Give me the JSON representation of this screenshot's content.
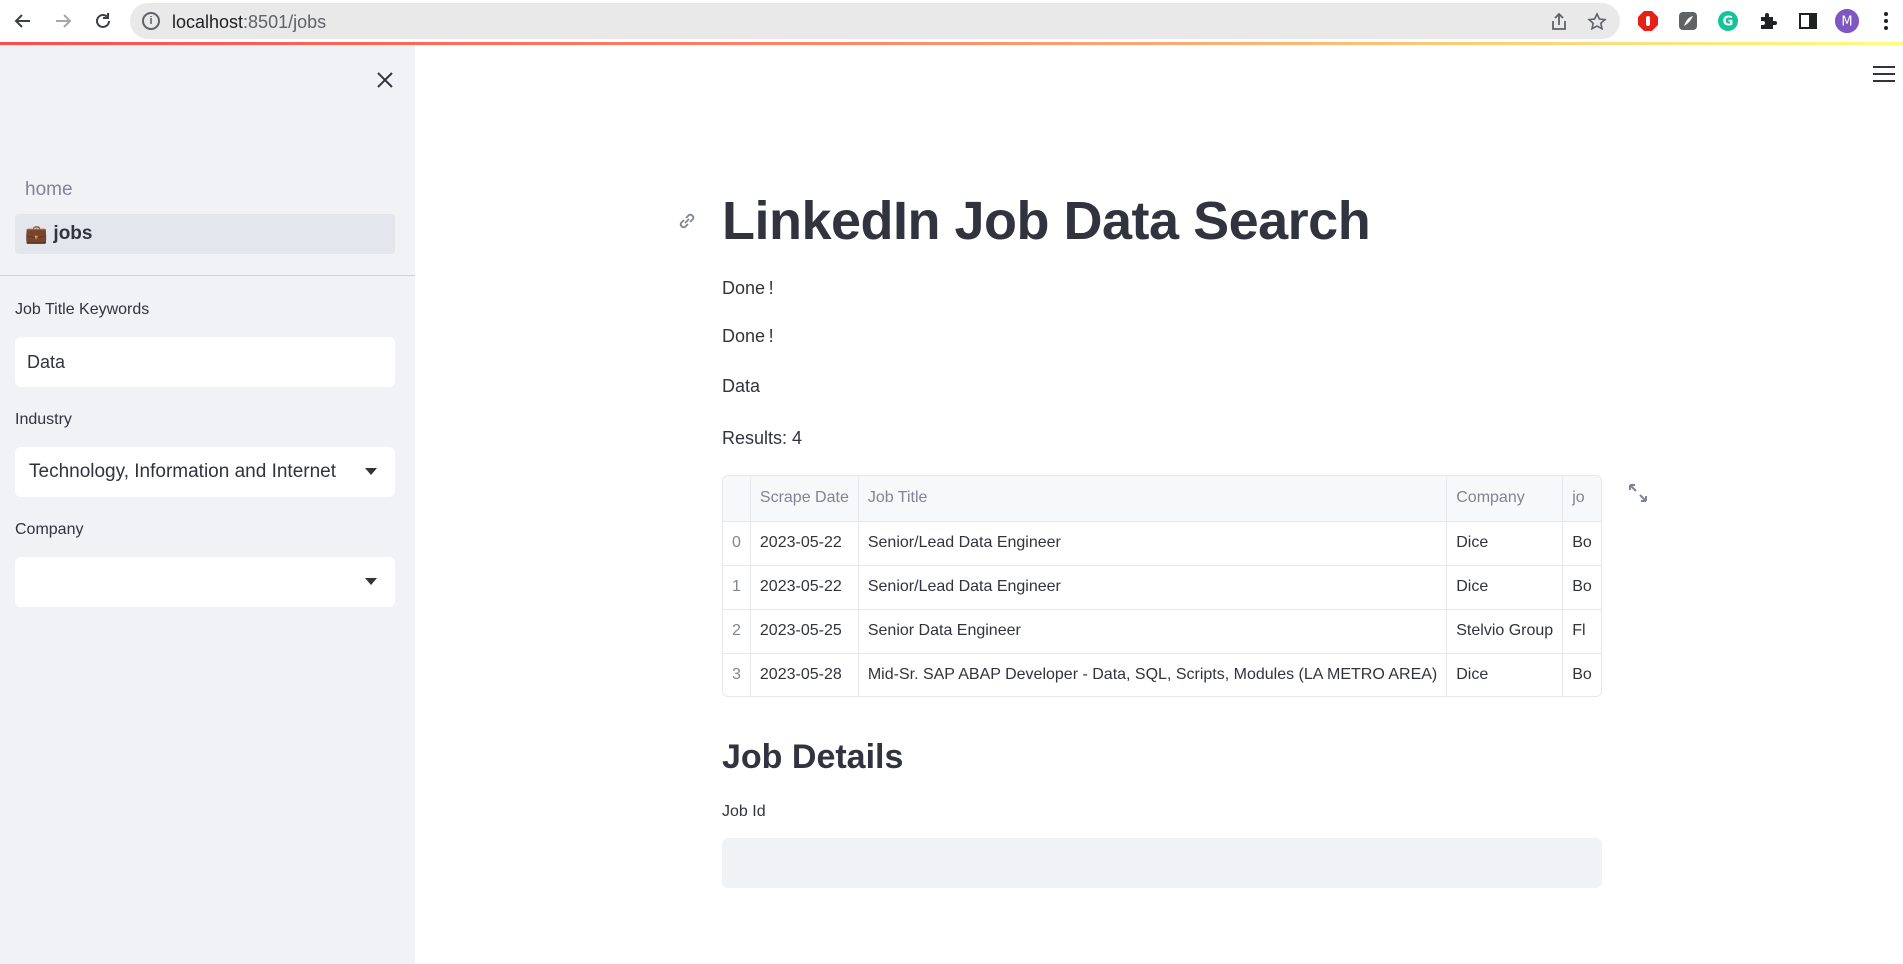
{
  "browser": {
    "url_host": "localhost",
    "url_path": ":8501/jobs",
    "profile_initial": "M"
  },
  "sidebar": {
    "nav": [
      {
        "label": "home"
      },
      {
        "label": "jobs",
        "emoji": "💼"
      }
    ],
    "job_title_keywords": {
      "label": "Job Title Keywords",
      "value": "Data"
    },
    "industry": {
      "label": "Industry",
      "value": "Technology, Information and Internet"
    },
    "company": {
      "label": "Company",
      "value": ""
    }
  },
  "main": {
    "title": "LinkedIn Job Data Search",
    "status_1": "Done !",
    "status_2": "Done !",
    "query_echo": "Data",
    "results": "Results: 4",
    "table": {
      "columns": [
        "",
        "Scrape Date",
        "Job Title",
        "Company",
        "jo"
      ],
      "rows": [
        {
          "idx": "0",
          "date": "2023-05-22",
          "title": "Senior/Lead Data Engineer",
          "company": "Dice",
          "loc": "Bo"
        },
        {
          "idx": "1",
          "date": "2023-05-22",
          "title": "Senior/Lead Data Engineer",
          "company": "Dice",
          "loc": "Bo"
        },
        {
          "idx": "2",
          "date": "2023-05-25",
          "title": "Senior Data Engineer",
          "company": "Stelvio Group",
          "loc": "Fl"
        },
        {
          "idx": "3",
          "date": "2023-05-28",
          "title": "Mid-Sr. SAP ABAP Developer - Data, SQL, Scripts, Modules (LA METRO AREA)",
          "company": "Dice",
          "loc": "Bo"
        }
      ]
    },
    "details_title": "Job Details",
    "job_id_label": "Job Id",
    "job_id_value": ""
  }
}
